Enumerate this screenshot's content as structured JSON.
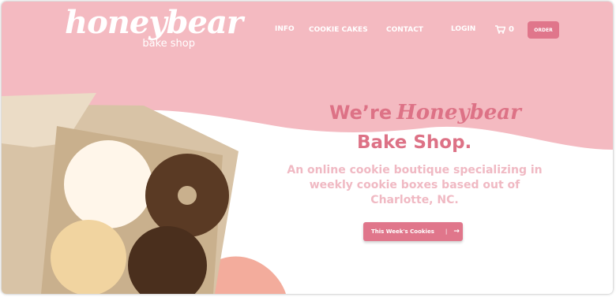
{
  "brand": {
    "name": "honeybear",
    "sub": "bake shop"
  },
  "nav": {
    "info": "INFO",
    "cookie_cakes": "COOKIE CAKES",
    "contact": "CONTACT",
    "login": "LOGIN",
    "cart_count": "0",
    "order": "ORDER"
  },
  "hero": {
    "line1_prefix": "We’re",
    "line1_brand": "Honeybear",
    "line2": "Bake Shop.",
    "description": "An online cookie boutique specializing in weekly cookie boxes based out of Charlotte, NC.",
    "cta_label": "This Week's Cookies",
    "cta_arrow": "→"
  },
  "colors": {
    "pink_bg": "#f4bac1",
    "accent": "#e0768b",
    "peach": "#f3ac9c",
    "text_light": "#f0b9c3"
  },
  "icons": {
    "cart": "cart-icon",
    "arrow": "arrow-right-icon",
    "logo_ears": "bear-ears-icon"
  }
}
